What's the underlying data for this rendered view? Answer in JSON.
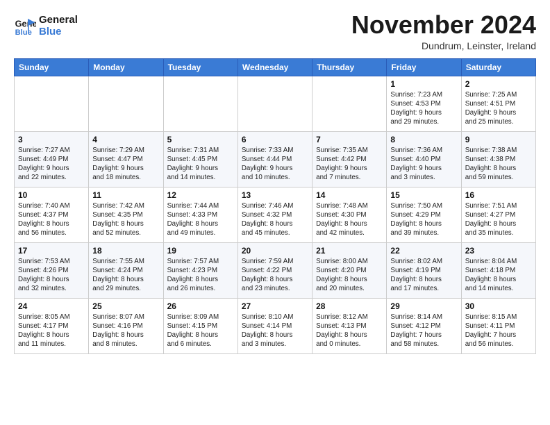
{
  "logo": {
    "line1": "General",
    "line2": "Blue"
  },
  "title": "November 2024",
  "location": "Dundrum, Leinster, Ireland",
  "weekdays": [
    "Sunday",
    "Monday",
    "Tuesday",
    "Wednesday",
    "Thursday",
    "Friday",
    "Saturday"
  ],
  "weeks": [
    [
      {
        "day": "",
        "info": ""
      },
      {
        "day": "",
        "info": ""
      },
      {
        "day": "",
        "info": ""
      },
      {
        "day": "",
        "info": ""
      },
      {
        "day": "",
        "info": ""
      },
      {
        "day": "1",
        "info": "Sunrise: 7:23 AM\nSunset: 4:53 PM\nDaylight: 9 hours\nand 29 minutes."
      },
      {
        "day": "2",
        "info": "Sunrise: 7:25 AM\nSunset: 4:51 PM\nDaylight: 9 hours\nand 25 minutes."
      }
    ],
    [
      {
        "day": "3",
        "info": "Sunrise: 7:27 AM\nSunset: 4:49 PM\nDaylight: 9 hours\nand 22 minutes."
      },
      {
        "day": "4",
        "info": "Sunrise: 7:29 AM\nSunset: 4:47 PM\nDaylight: 9 hours\nand 18 minutes."
      },
      {
        "day": "5",
        "info": "Sunrise: 7:31 AM\nSunset: 4:45 PM\nDaylight: 9 hours\nand 14 minutes."
      },
      {
        "day": "6",
        "info": "Sunrise: 7:33 AM\nSunset: 4:44 PM\nDaylight: 9 hours\nand 10 minutes."
      },
      {
        "day": "7",
        "info": "Sunrise: 7:35 AM\nSunset: 4:42 PM\nDaylight: 9 hours\nand 7 minutes."
      },
      {
        "day": "8",
        "info": "Sunrise: 7:36 AM\nSunset: 4:40 PM\nDaylight: 9 hours\nand 3 minutes."
      },
      {
        "day": "9",
        "info": "Sunrise: 7:38 AM\nSunset: 4:38 PM\nDaylight: 8 hours\nand 59 minutes."
      }
    ],
    [
      {
        "day": "10",
        "info": "Sunrise: 7:40 AM\nSunset: 4:37 PM\nDaylight: 8 hours\nand 56 minutes."
      },
      {
        "day": "11",
        "info": "Sunrise: 7:42 AM\nSunset: 4:35 PM\nDaylight: 8 hours\nand 52 minutes."
      },
      {
        "day": "12",
        "info": "Sunrise: 7:44 AM\nSunset: 4:33 PM\nDaylight: 8 hours\nand 49 minutes."
      },
      {
        "day": "13",
        "info": "Sunrise: 7:46 AM\nSunset: 4:32 PM\nDaylight: 8 hours\nand 45 minutes."
      },
      {
        "day": "14",
        "info": "Sunrise: 7:48 AM\nSunset: 4:30 PM\nDaylight: 8 hours\nand 42 minutes."
      },
      {
        "day": "15",
        "info": "Sunrise: 7:50 AM\nSunset: 4:29 PM\nDaylight: 8 hours\nand 39 minutes."
      },
      {
        "day": "16",
        "info": "Sunrise: 7:51 AM\nSunset: 4:27 PM\nDaylight: 8 hours\nand 35 minutes."
      }
    ],
    [
      {
        "day": "17",
        "info": "Sunrise: 7:53 AM\nSunset: 4:26 PM\nDaylight: 8 hours\nand 32 minutes."
      },
      {
        "day": "18",
        "info": "Sunrise: 7:55 AM\nSunset: 4:24 PM\nDaylight: 8 hours\nand 29 minutes."
      },
      {
        "day": "19",
        "info": "Sunrise: 7:57 AM\nSunset: 4:23 PM\nDaylight: 8 hours\nand 26 minutes."
      },
      {
        "day": "20",
        "info": "Sunrise: 7:59 AM\nSunset: 4:22 PM\nDaylight: 8 hours\nand 23 minutes."
      },
      {
        "day": "21",
        "info": "Sunrise: 8:00 AM\nSunset: 4:20 PM\nDaylight: 8 hours\nand 20 minutes."
      },
      {
        "day": "22",
        "info": "Sunrise: 8:02 AM\nSunset: 4:19 PM\nDaylight: 8 hours\nand 17 minutes."
      },
      {
        "day": "23",
        "info": "Sunrise: 8:04 AM\nSunset: 4:18 PM\nDaylight: 8 hours\nand 14 minutes."
      }
    ],
    [
      {
        "day": "24",
        "info": "Sunrise: 8:05 AM\nSunset: 4:17 PM\nDaylight: 8 hours\nand 11 minutes."
      },
      {
        "day": "25",
        "info": "Sunrise: 8:07 AM\nSunset: 4:16 PM\nDaylight: 8 hours\nand 8 minutes."
      },
      {
        "day": "26",
        "info": "Sunrise: 8:09 AM\nSunset: 4:15 PM\nDaylight: 8 hours\nand 6 minutes."
      },
      {
        "day": "27",
        "info": "Sunrise: 8:10 AM\nSunset: 4:14 PM\nDaylight: 8 hours\nand 3 minutes."
      },
      {
        "day": "28",
        "info": "Sunrise: 8:12 AM\nSunset: 4:13 PM\nDaylight: 8 hours\nand 0 minutes."
      },
      {
        "day": "29",
        "info": "Sunrise: 8:14 AM\nSunset: 4:12 PM\nDaylight: 7 hours\nand 58 minutes."
      },
      {
        "day": "30",
        "info": "Sunrise: 8:15 AM\nSunset: 4:11 PM\nDaylight: 7 hours\nand 56 minutes."
      }
    ]
  ]
}
